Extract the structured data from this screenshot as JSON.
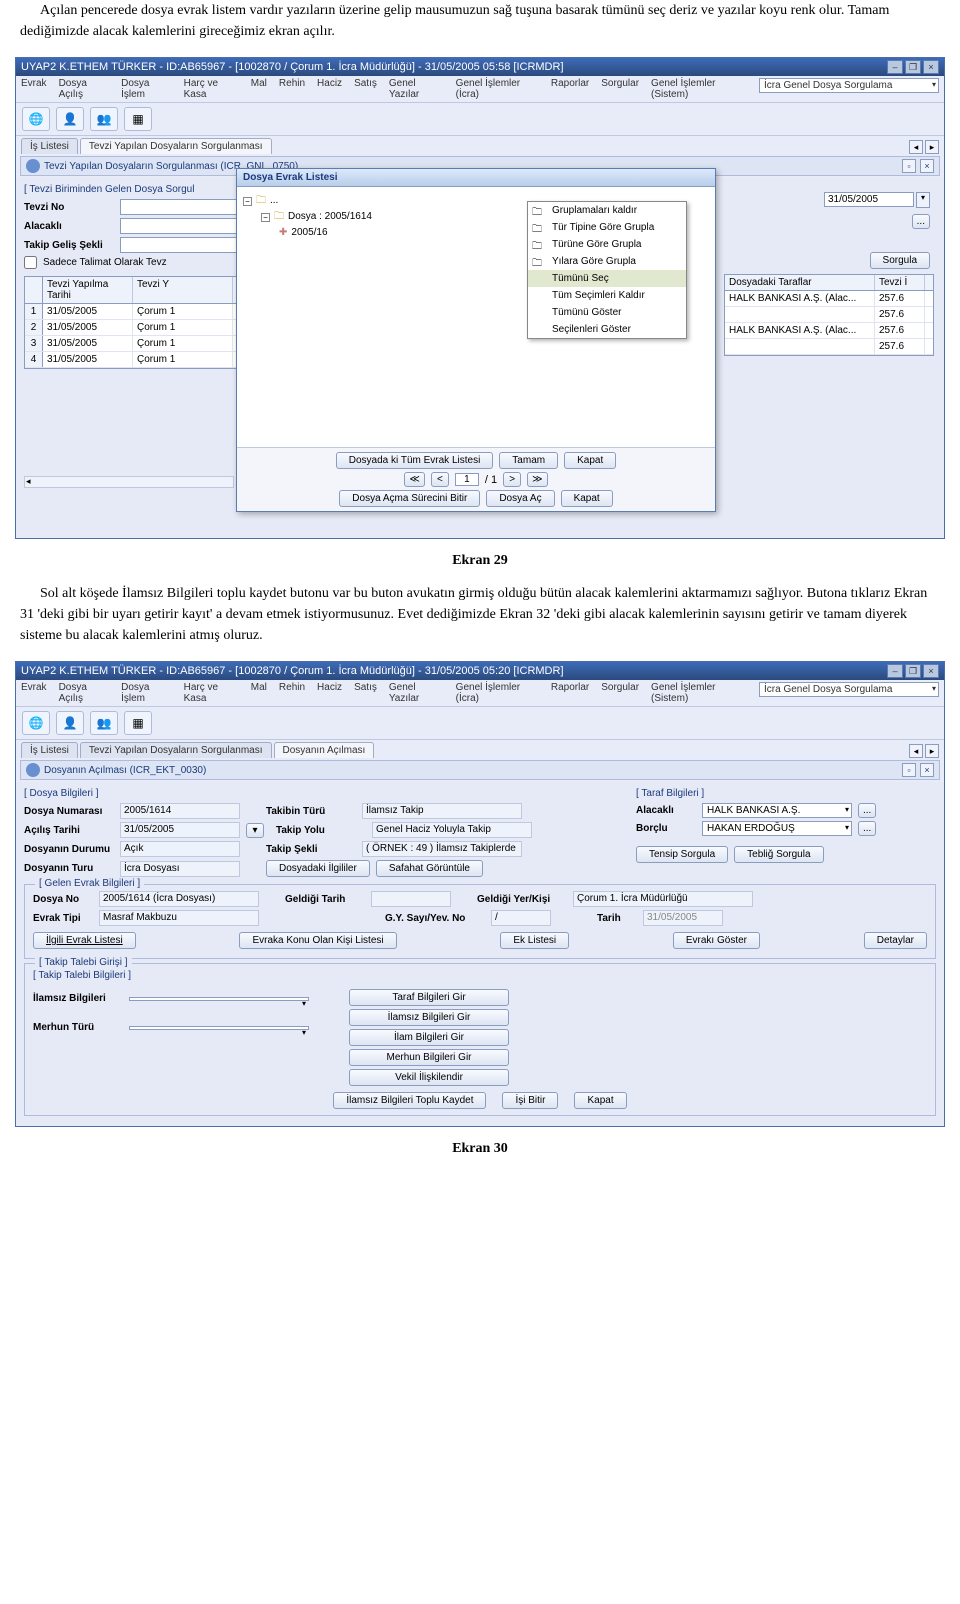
{
  "doc": {
    "para1": "Açılan pencerede dosya evrak listem vardır yazıların üzerine gelip mausumuzun sağ tuşuna basarak tümünü seç deriz ve yazılar koyu renk olur. Tamam dediğimizde alacak kalemlerini gireceğimiz ekran açılır.",
    "caption1": "Ekran 29",
    "para2": "Sol alt köşede İlamsız Bilgileri toplu kaydet butonu var bu buton avukatın girmiş olduğu bütün alacak kalemlerini aktarmamızı sağlıyor. Butona tıklarız Ekran 31 'deki gibi bir uyarı getirir kayıt' a devam etmek istiyormusunuz. Evet dediğimizde Ekran 32 'deki gibi alacak kalemlerinin sayısını getirir ve tamam diyerek sisteme bu alacak kalemlerini atmış oluruz.",
    "caption2": "Ekran 30"
  },
  "app1": {
    "title": "UYAP2   K.ETHEM TÜRKER - ID:AB65967 - [1002870 / Çorum 1. İcra Müdürlüğü] - 31/05/2005 05:58 [ICRMDR]",
    "menus": [
      "Evrak",
      "Dosya Açılış",
      "Dosya İşlem",
      "Harç ve Kasa",
      "Mal",
      "Rehin",
      "Haciz",
      "Satış",
      "Genel Yazılar",
      "Genel İşlemler (İcra)",
      "Raporlar",
      "Sorgular",
      "Genel İşlemler (Sistem)"
    ],
    "top_dd": "İcra Genel Dosya Sorgulama",
    "tabs": [
      "İş Listesi",
      "Tevzi Yapılan Dosyaların Sorgulanması"
    ],
    "subheader": "Tevzi Yapılan Dosyaların Sorgulanması (ICR_GNL_0750)",
    "section": "[ Tevzi Biriminden Gelen Dosya Sorgul",
    "labels": {
      "tevzi_no": "Tevzi No",
      "alacakli": "Alacaklı",
      "takip_gelis": "Takip Geliş Şekli",
      "checkbox": "Sadece Talimat Olarak Tevz"
    },
    "right_date": "31/05/2005",
    "sorgula": "Sorgula",
    "table": {
      "headers": [
        "Tevzi Yapılma Tarihi",
        "Tevzi Y"
      ],
      "rows": [
        [
          "1",
          "31/05/2005",
          "Çorum 1"
        ],
        [
          "2",
          "31/05/2005",
          "Çorum 1"
        ],
        [
          "3",
          "31/05/2005",
          "Çorum 1"
        ],
        [
          "4",
          "31/05/2005",
          "Çorum 1"
        ]
      ]
    },
    "right_table": {
      "headers": [
        "Dosyadaki Taraflar",
        "Tevzi İ"
      ],
      "rows": [
        [
          "HALK BANKASI A.Ş. (Alac...",
          "257.6"
        ],
        [
          "",
          "257.6"
        ],
        [
          "HALK BANKASI A.Ş. (Alac...",
          "257.6"
        ],
        [
          "",
          "257.6"
        ]
      ]
    },
    "dialog": {
      "title": "Dosya Evrak Listesi",
      "tree": {
        "root": "...",
        "dosya": "Dosya : 2005/1614",
        "child": "2005/16"
      },
      "menu": [
        "Gruplamaları kaldır",
        "Tür Tipine Göre Grupla",
        "Türüne Göre Grupla",
        "Yılara Göre Grupla",
        "Tümünü Seç",
        "Tüm Seçimleri Kaldır",
        "Tümünü Göster",
        "Seçilenleri Göster"
      ],
      "footer": {
        "btn1": "Dosyada ki Tüm Evrak Listesi",
        "btn2": "Tamam",
        "btn3": "Kapat",
        "page": "1",
        "pages": "/ 1",
        "btn4": "Dosya Açma Sürecini Bitir",
        "btn5": "Dosya Aç",
        "btn6": "Kapat"
      }
    }
  },
  "app2": {
    "title": "UYAP2   K.ETHEM TÜRKER - ID:AB65967 - [1002870 / Çorum 1. İcra Müdürlüğü] - 31/05/2005 05:20 [ICRMDR]",
    "tabs": [
      "İş Listesi",
      "Tevzi Yapılan Dosyaların Sorgulanması",
      "Dosyanın Açılması"
    ],
    "subheader": "Dosyanın Açılması (ICR_EKT_0030)",
    "dosya_bilgileri": {
      "legend": "[ Dosya Bilgileri ]",
      "dosya_no_lbl": "Dosya Numarası",
      "dosya_no": "2005/1614",
      "acilis_lbl": "Açılış Tarihi",
      "acilis": "31/05/2005",
      "durum_lbl": "Dosyanın Durumu",
      "durum": "Açık",
      "turu_lbl": "Dosyanın Turu",
      "turu": "İcra Dosyası",
      "takibin_turu_lbl": "Takibin Türü",
      "takibin_turu": "İlamsız Takip",
      "takip_yolu_lbl": "Takip Yolu",
      "takip_yolu": "Genel Haciz Yoluyla Takip",
      "takip_sekli_lbl": "Takip Şekli",
      "takip_sekli": "( ÖRNEK : 49 ) İlamsız Takiplerde",
      "btns": [
        "Dosyadaki İlgililer",
        "Safahat Görüntüle"
      ]
    },
    "taraf_bilgileri": {
      "legend": "[ Taraf Bilgileri ]",
      "alacakli_lbl": "Alacaklı",
      "alacakli": "HALK BANKASI A.Ş.",
      "borclu_lbl": "Borçlu",
      "borclu": "HAKAN ERDOĞUŞ",
      "btns": [
        "Tensip Sorgula",
        "Tebliğ Sorgula"
      ]
    },
    "gelen_evrak": {
      "legend": "[ Gelen Evrak Bilgileri ]",
      "dosya_no_lbl": "Dosya No",
      "dosya_no": "2005/1614 (İcra Dosyası)",
      "geldigi_tarih_lbl": "Geldiği Tarih",
      "geldigi_yer_lbl": "Geldiği Yer/Kişi",
      "geldigi_yer": "Çorum 1. İcra Müdürlüğü",
      "evrak_tipi_lbl": "Evrak Tipi",
      "evrak_tipi": "Masraf Makbuzu",
      "gy_lbl": "G.Y. Sayı/Yev. No",
      "gy": "/",
      "tarih_lbl": "Tarih",
      "tarih": "31/05/2005",
      "btns": [
        "İlgili Evrak Listesi",
        "Evraka Konu Olan Kişi Listesi",
        "Ek Listesi",
        "Evrakı Göster",
        "Detaylar"
      ]
    },
    "takip_talebi": {
      "legend": "[ Takip Talebi Girişi ]",
      "legend2": "[ Takip Talebi Bilgileri ]",
      "ilamsiz_lbl": "İlamsız Bilgileri",
      "merhun_lbl": "Merhun Türü",
      "stack": [
        "Taraf Bilgileri Gir",
        "İlamsız Bilgileri Gir",
        "İlam Bilgileri Gir",
        "Merhun Bilgileri Gir",
        "Vekil İlişkilendir"
      ],
      "bottom": [
        "İlamsız Bilgileri Toplu Kaydet",
        "İşi Bitir",
        "Kapat"
      ]
    }
  }
}
